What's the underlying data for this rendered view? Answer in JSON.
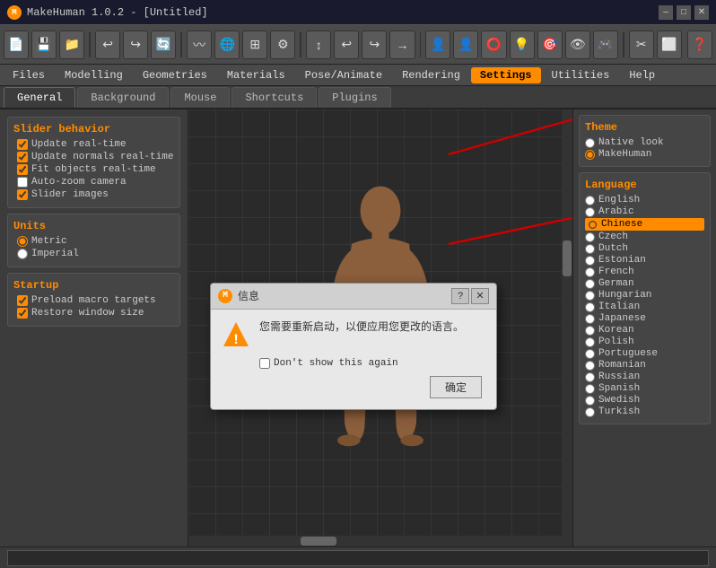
{
  "titleBar": {
    "appIcon": "M",
    "title": "MakeHuman 1.0.2 - [Untitled]",
    "minBtn": "–",
    "maxBtn": "□",
    "closeBtn": "✕"
  },
  "toolbar": {
    "buttons": [
      "💾",
      "📁",
      "⬛",
      "↩",
      "↪",
      "🔄",
      "〰",
      "🌐",
      "⊞",
      "⚙",
      "↕",
      "↩",
      "↪",
      "→",
      "👤",
      "👤",
      "⭕",
      "💡",
      "🎯",
      "👁",
      "🎮",
      "✂",
      "⬜",
      "❓"
    ]
  },
  "menuBar": {
    "items": [
      "Files",
      "Modelling",
      "Geometries",
      "Materials",
      "Pose/Animate",
      "Rendering",
      "Settings",
      "Utilities",
      "Help"
    ],
    "activeItem": "Settings"
  },
  "tabs": {
    "items": [
      "General",
      "Background",
      "Mouse",
      "Shortcuts",
      "Plugins"
    ],
    "activeTab": "General"
  },
  "leftPanel": {
    "sliderBehavior": {
      "title": "Slider behavior",
      "items": [
        {
          "label": "Update real-time",
          "checked": true
        },
        {
          "label": "Update normals real-time",
          "checked": true
        },
        {
          "label": "Fit objects real-time",
          "checked": true
        },
        {
          "label": "Auto-zoom camera",
          "checked": false
        },
        {
          "label": "Slider images",
          "checked": true
        }
      ]
    },
    "units": {
      "title": "Units",
      "items": [
        {
          "label": "Metric",
          "selected": true
        },
        {
          "label": "Imperial",
          "selected": false
        }
      ]
    },
    "startup": {
      "title": "Startup",
      "items": [
        {
          "label": "Preload macro targets",
          "checked": true
        },
        {
          "label": "Restore window size",
          "checked": true
        }
      ]
    }
  },
  "rightPanel": {
    "theme": {
      "title": "Theme",
      "items": [
        {
          "label": "Native look",
          "selected": false
        },
        {
          "label": "MakeHuman",
          "selected": true
        }
      ]
    },
    "language": {
      "title": "Language",
      "items": [
        {
          "label": "English",
          "selected": false
        },
        {
          "label": "Arabic",
          "selected": false
        },
        {
          "label": "Chinese",
          "selected": true
        },
        {
          "label": "Czech",
          "selected": false
        },
        {
          "label": "Dutch",
          "selected": false
        },
        {
          "label": "Estonian",
          "selected": false
        },
        {
          "label": "French",
          "selected": false
        },
        {
          "label": "German",
          "selected": false
        },
        {
          "label": "Hungarian",
          "selected": false
        },
        {
          "label": "Italian",
          "selected": false
        },
        {
          "label": "Japanese",
          "selected": false
        },
        {
          "label": "Korean",
          "selected": false
        },
        {
          "label": "Polish",
          "selected": false
        },
        {
          "label": "Portuguese",
          "selected": false
        },
        {
          "label": "Romanian",
          "selected": false
        },
        {
          "label": "Russian",
          "selected": false
        },
        {
          "label": "Spanish",
          "selected": false
        },
        {
          "label": "Swedish",
          "selected": false
        },
        {
          "label": "Turkish",
          "selected": false
        }
      ]
    }
  },
  "dialog": {
    "titleIcon": "M",
    "title": "信息",
    "questionBtn": "?",
    "closeBtn": "✕",
    "message": "您需要重新启动，以便应用您更改的语言。",
    "checkboxLabel": "Don't show this again",
    "okBtn": "确定"
  },
  "bottomBar": {
    "inputValue": ""
  }
}
